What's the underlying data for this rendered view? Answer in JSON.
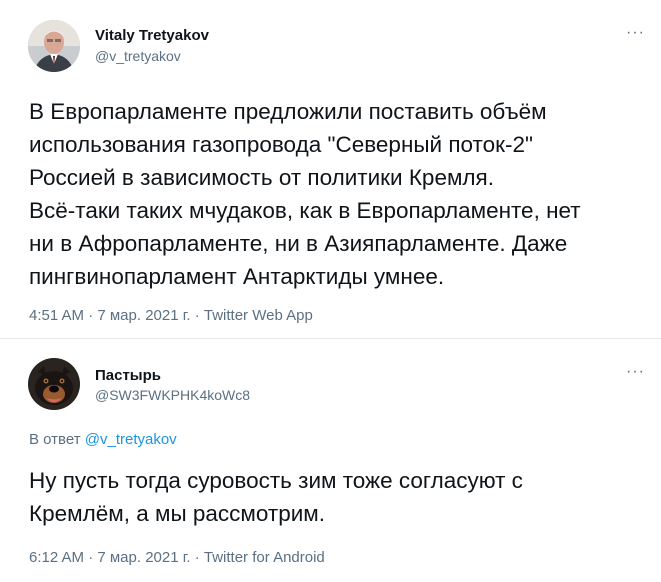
{
  "tweets": [
    {
      "author_name": "Vitaly Tretyakov",
      "author_handle": "@v_tretyakov",
      "more_label": "···",
      "text": "В Европарламенте предложили поставить объём\nиспользования газопровода \"Северный поток-2\"\nРоссией в зависимость от политики Кремля.\nВсё-таки таких мчудаков, как в Европарламенте, нет\nни в Афропарламенте, ни в Азияпарламенте. Даже\nпингвинопарламент Антарктиды умнее.",
      "meta": "4:51 AM · 7 мар. 2021 г. · Twitter Web App"
    },
    {
      "author_name": "Пастырь",
      "author_handle": "@SW3FWKPHK4koWc8",
      "more_label": "···",
      "reply_prefix": "В ответ",
      "reply_mention": "@v_tretyakov",
      "text": "Ну пусть тогда суровость зим тоже согласуют с\nКремлём, а мы рассмотрим.",
      "meta": "6:12 AM · 7 мар. 2021 г. · Twitter for Android"
    }
  ],
  "colors": {
    "text": "#0f1419",
    "secondary": "#5b7083",
    "link": "#1b95e0",
    "divider": "#e3e7ea"
  }
}
